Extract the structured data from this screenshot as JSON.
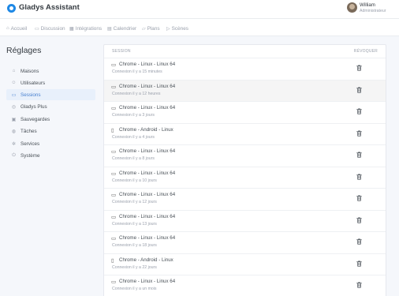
{
  "app": {
    "title": "Gladys Assistant",
    "user_name": "William",
    "user_role": "Administrateur"
  },
  "nav": [
    {
      "label": "Accueil",
      "icon": "home-icon",
      "glyph": "⌂"
    },
    {
      "label": "Discussion",
      "icon": "chat-icon",
      "glyph": "▭"
    },
    {
      "label": "Intégrations",
      "icon": "grid-icon",
      "glyph": "▦"
    },
    {
      "label": "Calendrier",
      "icon": "calendar-icon",
      "glyph": "▤"
    },
    {
      "label": "Plans",
      "icon": "map-icon",
      "glyph": "▱"
    },
    {
      "label": "Scènes",
      "icon": "play-icon",
      "glyph": "▷"
    }
  ],
  "page": {
    "title": "Réglages"
  },
  "sidebar": [
    {
      "label": "Maisons",
      "icon": "house-icon",
      "glyph": "⌂",
      "active": false
    },
    {
      "label": "Utilisateurs",
      "icon": "user-icon",
      "glyph": "☺",
      "active": false
    },
    {
      "label": "Sessions",
      "icon": "key-icon",
      "glyph": "▭",
      "active": true
    },
    {
      "label": "Gladys Plus",
      "icon": "globe-icon",
      "glyph": "◎",
      "active": false
    },
    {
      "label": "Sauvegardes",
      "icon": "save-icon",
      "glyph": "▣",
      "active": false
    },
    {
      "label": "Tâches",
      "icon": "tasks-icon",
      "glyph": "◍",
      "active": false
    },
    {
      "label": "Services",
      "icon": "settings-icon",
      "glyph": "✲",
      "active": false
    },
    {
      "label": "Système",
      "icon": "power-icon",
      "glyph": "⏻",
      "active": false
    }
  ],
  "sessions": {
    "header_session": "SESSION",
    "header_revoke": "RÉVOQUER",
    "rows": [
      {
        "device": "Chrome - Linux - Linux 64",
        "type": "desktop",
        "icon": "monitor-icon",
        "glyph": "▭",
        "time": "Connexion il y a 15 minutes",
        "highlight": false
      },
      {
        "device": "Chrome - Linux - Linux 64",
        "type": "desktop",
        "icon": "monitor-icon",
        "glyph": "▭",
        "time": "Connexion il y a 12 heures",
        "highlight": true
      },
      {
        "device": "Chrome - Linux - Linux 64",
        "type": "desktop",
        "icon": "monitor-icon",
        "glyph": "▭",
        "time": "Connexion il y a 3 jours",
        "highlight": false
      },
      {
        "device": "Chrome - Android - Linux",
        "type": "mobile",
        "icon": "phone-icon",
        "glyph": "▯",
        "time": "Connexion il y a 4 jours",
        "highlight": false
      },
      {
        "device": "Chrome - Linux - Linux 64",
        "type": "desktop",
        "icon": "monitor-icon",
        "glyph": "▭",
        "time": "Connexion il y a 8 jours",
        "highlight": false
      },
      {
        "device": "Chrome - Linux - Linux 64",
        "type": "desktop",
        "icon": "monitor-icon",
        "glyph": "▭",
        "time": "Connexion il y a 10 jours",
        "highlight": false
      },
      {
        "device": "Chrome - Linux - Linux 64",
        "type": "desktop",
        "icon": "monitor-icon",
        "glyph": "▭",
        "time": "Connexion il y a 12 jours",
        "highlight": false
      },
      {
        "device": "Chrome - Linux - Linux 64",
        "type": "desktop",
        "icon": "monitor-icon",
        "glyph": "▭",
        "time": "Connexion il y a 13 jours",
        "highlight": false
      },
      {
        "device": "Chrome - Linux - Linux 64",
        "type": "desktop",
        "icon": "monitor-icon",
        "glyph": "▭",
        "time": "Connexion il y a 18 jours",
        "highlight": false
      },
      {
        "device": "Chrome - Android - Linux",
        "type": "mobile",
        "icon": "phone-icon",
        "glyph": "▯",
        "time": "Connexion il y a 22 jours",
        "highlight": false
      },
      {
        "device": "Chrome - Linux - Linux 64",
        "type": "desktop",
        "icon": "monitor-icon",
        "glyph": "▭",
        "time": "Connexion il y a un mois",
        "highlight": false
      }
    ]
  },
  "colors": {
    "accent": "#467fcf",
    "logo": "#1e88e5",
    "active_bg": "#e8f0fb"
  }
}
